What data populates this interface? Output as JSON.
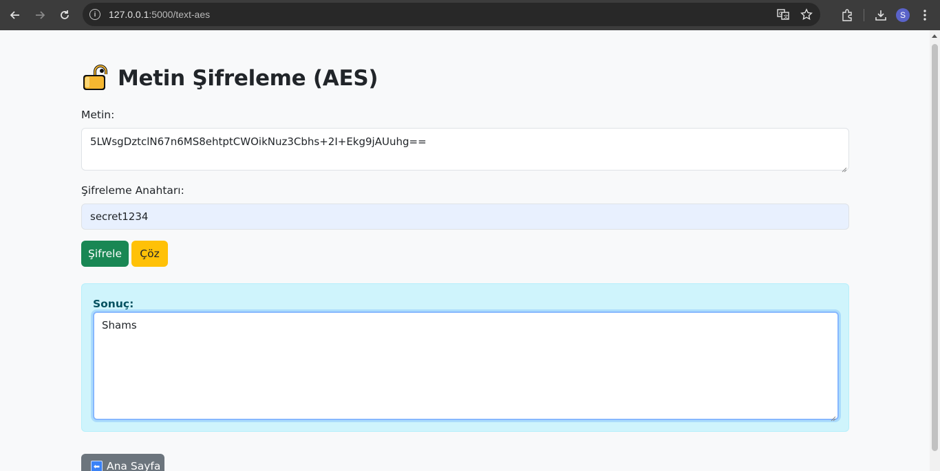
{
  "browser": {
    "url_host": "127.0.0.1",
    "url_rest": ":5000/text-aes",
    "profile_initial": "S"
  },
  "page": {
    "title": "Metin Şifreleme (AES)",
    "text_label": "Metin:",
    "text_value": "5LWsgDztclN67n6MS8ehtptCWOikNuz3Cbhs+2I+Ekg9jAUuhg==",
    "key_label": "Şifreleme Anahtarı:",
    "key_value": "secret1234",
    "encrypt_button": "Şifrele",
    "decrypt_button": "Çöz",
    "result_label": "Sonuç:",
    "result_value": "Shams",
    "home_button": "Ana Sayfa"
  },
  "colors": {
    "encrypt": "#198754",
    "decrypt": "#ffc107",
    "result_bg": "#cff4fc",
    "home": "#6c757d"
  }
}
